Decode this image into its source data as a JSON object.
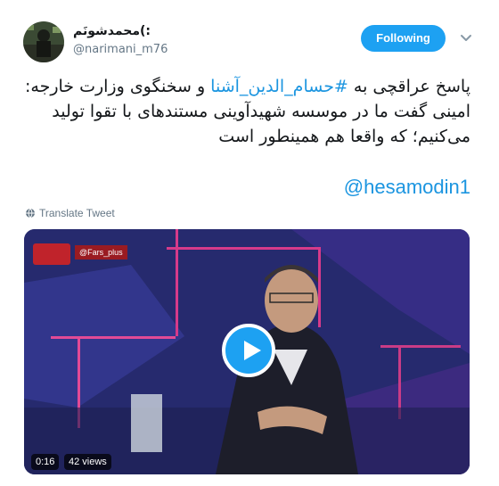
{
  "tweet": {
    "display_name": ":)محمدشونَم",
    "handle": "@narimani_m76",
    "follow_label": "Following",
    "text_line1_start": "پاسخ عراقچی به ",
    "hashtag": "#حسام_الدین_آشنا",
    "text_line1_end": " و سخنگوی وزارت خارجه:",
    "text_body": "امینی گفت ما در موسسه شهیدآوینی مستندهای با تقوا تولید می‌کنیم؛ که واقعا هم همینطور است",
    "mention": "@hesamodin1",
    "translate_label": "Translate Tweet"
  },
  "video": {
    "duration": "0:16",
    "views": "42 views",
    "channel_handle": "@Fars_plus"
  },
  "colors": {
    "brand": "#1da1f2",
    "link": "#1b95e0",
    "muted": "#657786"
  },
  "icons": [
    "caret-down-icon",
    "globe-icon",
    "play-icon"
  ]
}
